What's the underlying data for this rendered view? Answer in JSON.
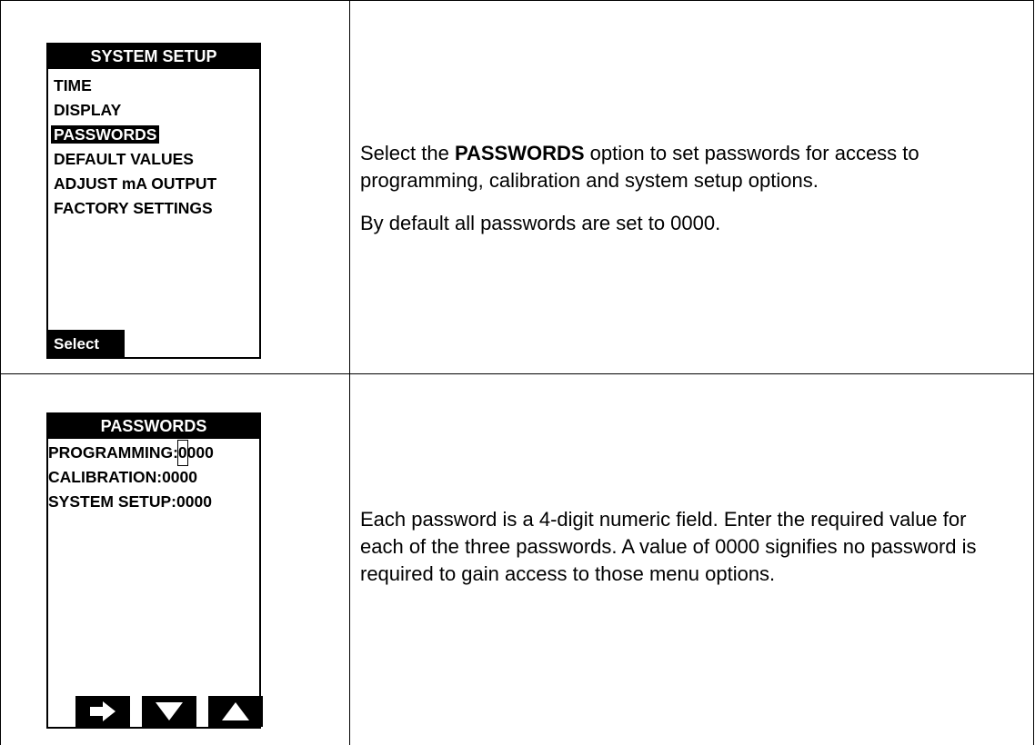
{
  "row1": {
    "screen": {
      "title": "SYSTEM SETUP",
      "items": [
        "TIME",
        "DISPLAY",
        "PASSWORDS",
        "DEFAULT VALUES",
        "ADJUST mA OUTPUT",
        "FACTORY SETTINGS"
      ],
      "selected_index": 2,
      "softkey_label": "Select"
    },
    "description": {
      "pre": "Select the ",
      "bold": "PASSWORDS",
      "post": " option to set passwords for access to programming, calibration and system setup options.",
      "note": "By default all passwords are set to 0000."
    }
  },
  "row2": {
    "screen": {
      "title": "PASSWORDS",
      "fields": [
        {
          "label": "PROGRAMMING:",
          "cursor_digit": "0",
          "rest": "000"
        },
        {
          "label": "CALIBRATION:",
          "value": "0000"
        },
        {
          "label": "SYSTEM SETUP:",
          "value": "0000"
        }
      ],
      "nav_icons": [
        "arrow-right-icon",
        "arrow-down-icon",
        "arrow-up-icon"
      ]
    },
    "description": {
      "text": "Each password is a 4-digit numeric field. Enter the required value for each of the three passwords. A value of 0000 signifies no password is required to gain access to those menu options."
    }
  }
}
